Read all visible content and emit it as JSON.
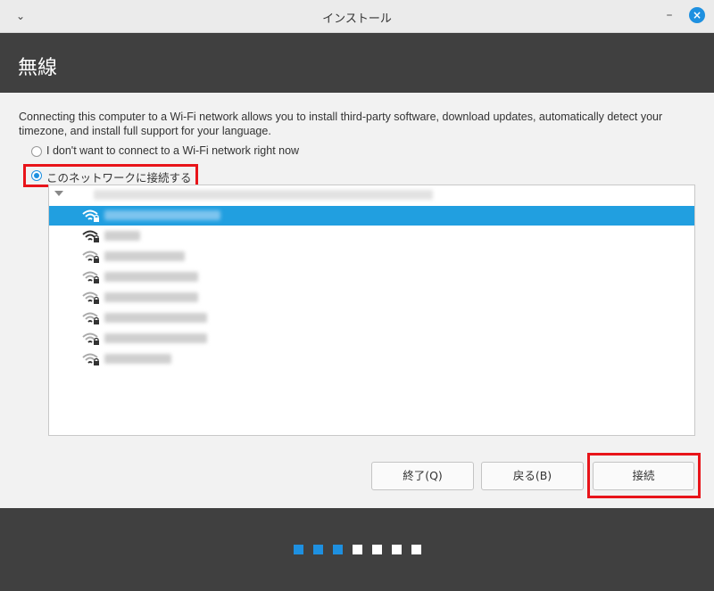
{
  "window": {
    "title": "インストール"
  },
  "header": {
    "title": "無線"
  },
  "description": "Connecting this computer to a Wi-Fi network allows you to install third-party software, download updates, automatically detect your timezone, and install full support for your language.",
  "options": [
    {
      "label": "I don't want to connect to a Wi-Fi network right now",
      "checked": false
    },
    {
      "label": "このネットワークに接続する",
      "checked": true
    }
  ],
  "networks": [
    {
      "signal": "strong",
      "locked": true,
      "selected": true
    },
    {
      "signal": "strong",
      "locked": true,
      "selected": false
    },
    {
      "signal": "weak",
      "locked": true,
      "selected": false
    },
    {
      "signal": "weak",
      "locked": true,
      "selected": false
    },
    {
      "signal": "weak",
      "locked": true,
      "selected": false
    },
    {
      "signal": "weak",
      "locked": true,
      "selected": false
    },
    {
      "signal": "weak",
      "locked": true,
      "selected": false
    },
    {
      "signal": "weak",
      "locked": true,
      "selected": false
    }
  ],
  "buttons": {
    "quit": "終了(Q)",
    "back": "戻る(B)",
    "connect": "接続"
  },
  "progress": {
    "total_steps": 7,
    "completed_steps": 3
  },
  "colors": {
    "accent": "#1e90e0",
    "selection": "#219fe0",
    "highlight": "#e8141a",
    "header_bg": "#404040"
  }
}
